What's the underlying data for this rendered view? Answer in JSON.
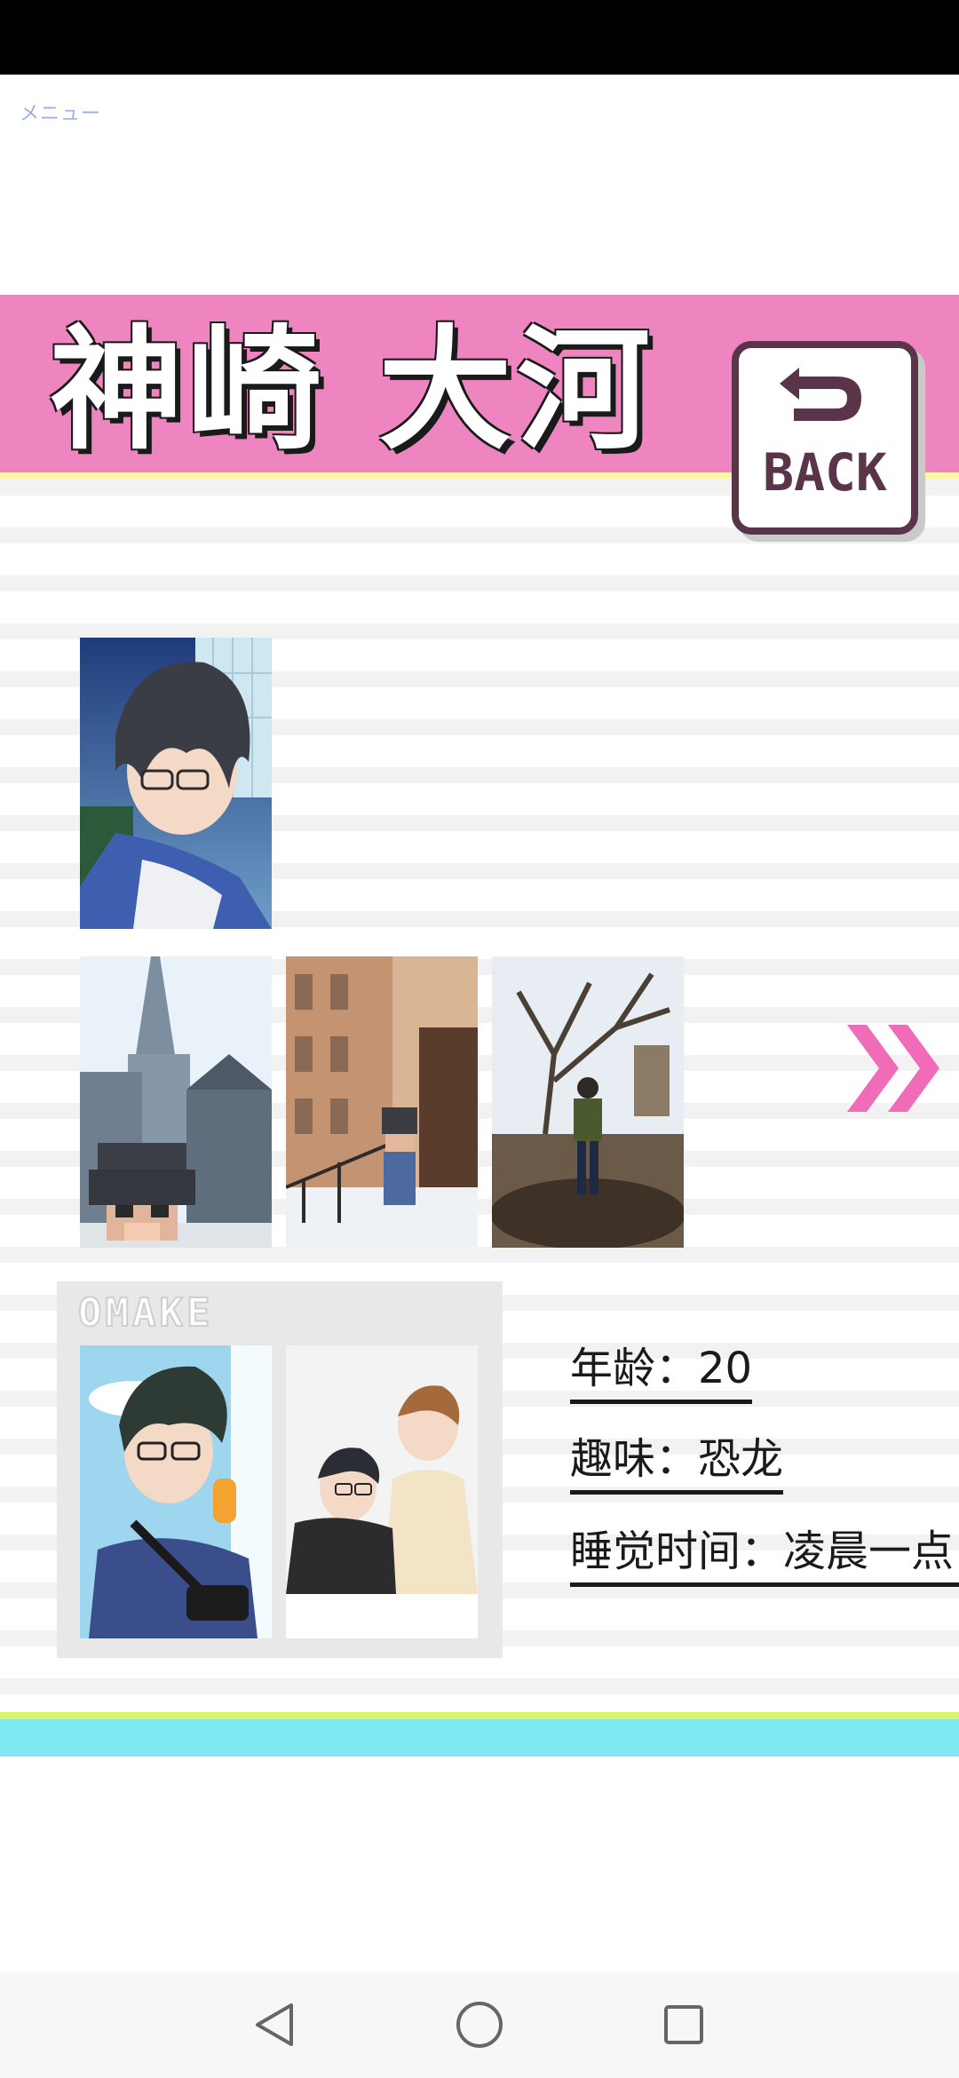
{
  "menu": {
    "label": "メニュー"
  },
  "character": {
    "name": "神崎 大河"
  },
  "back_button": {
    "label": "BACK"
  },
  "omake": {
    "title": "OMAKE"
  },
  "profile": {
    "age": "年龄：20",
    "hobby": "趣味：恐龙",
    "sleep": "睡觉时间：凌晨一点"
  },
  "colors": {
    "banner": "#ee84c0",
    "accent_yellow": "#fbf7a8",
    "accent_cyan": "#7fe9f2",
    "accent_green": "#d6f56a",
    "arrow": "#f06bb8"
  },
  "icons": {
    "back": "back-arrow-icon",
    "next": "double-chevron-right-icon",
    "nav_back": "triangle-back-icon",
    "nav_home": "circle-home-icon",
    "nav_recent": "square-recent-icon"
  }
}
